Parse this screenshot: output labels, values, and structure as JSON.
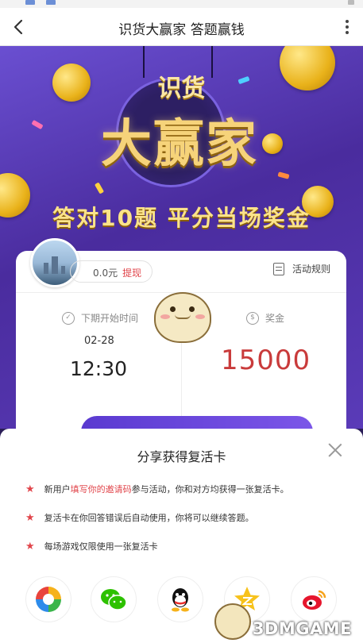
{
  "nav": {
    "title": "识货大赢家 答题赢钱",
    "back_icon": "chevron-left-icon",
    "more_icon": "more-vertical-icon"
  },
  "hero": {
    "logo_small": "识货",
    "logo_big": "大赢家",
    "slogan": "答对10题 平分当场奖金"
  },
  "card": {
    "balance": "0.0元",
    "withdraw": "提现",
    "rules": "活动规则",
    "next_time_label": "下期开始时间",
    "next_date": "02-28",
    "next_time": "12:30",
    "prize_label": "奖金",
    "prize_value": "15000"
  },
  "sheet": {
    "title": "分享获得复活卡",
    "rules": [
      {
        "pre": "新用户",
        "highlight": "填写你的邀请码",
        "post": "参与活动，你和对方均获得一张复活卡。"
      },
      {
        "pre": "复活卡在你回答错误后自动使用，你将可以继续答题。",
        "highlight": "",
        "post": ""
      },
      {
        "pre": "每场游戏仅限使用一张复活卡",
        "highlight": "",
        "post": ""
      }
    ],
    "share_icons": [
      "moments-icon",
      "wechat-icon",
      "qq-icon",
      "qzone-icon",
      "weibo-icon"
    ]
  },
  "watermark": "3DMGAME",
  "colors": {
    "accent": "#e1454b",
    "purple": "#5a3bb8",
    "gold": "#f6d37a"
  }
}
